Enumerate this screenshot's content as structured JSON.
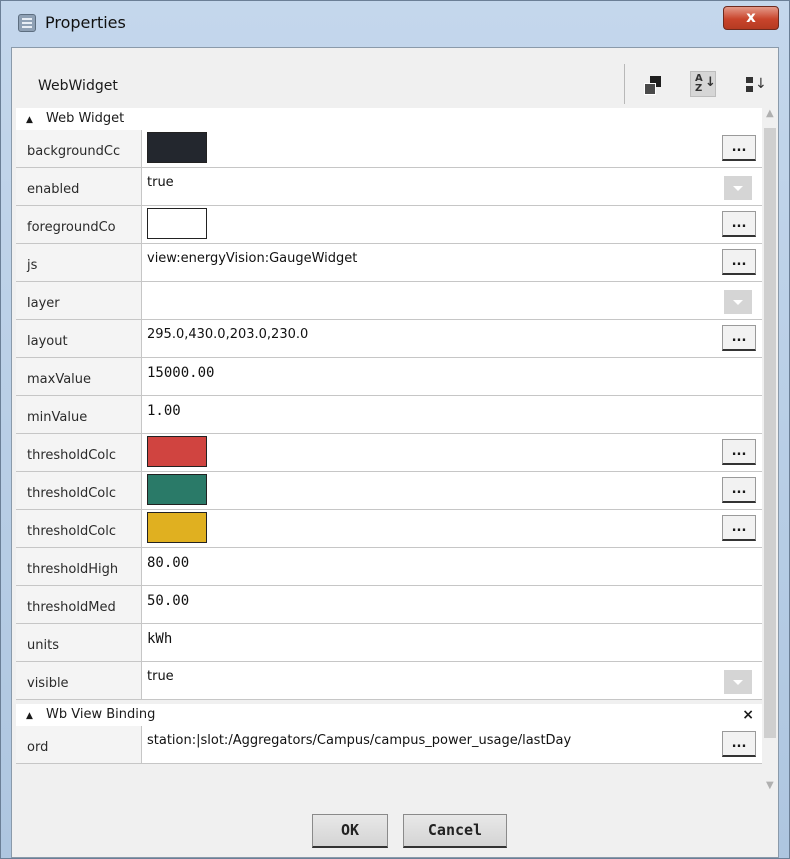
{
  "window": {
    "title": "Properties",
    "close_label": "x"
  },
  "header": {
    "title": "WebWidget"
  },
  "groups": {
    "web_widget": {
      "label": "Web Widget"
    },
    "wb_view_binding": {
      "label": "Wb View Binding",
      "close_glyph": "×"
    }
  },
  "properties": [
    {
      "name": "backgroundCc",
      "kind": "color",
      "color": "#23272e"
    },
    {
      "name": "enabled",
      "kind": "dropdown",
      "value": "true"
    },
    {
      "name": "foregroundCo",
      "kind": "color",
      "color": "#ffffff"
    },
    {
      "name": "js",
      "kind": "text-dots",
      "value": "view:energyVision:GaugeWidget"
    },
    {
      "name": "layer",
      "kind": "dropdown",
      "value": ""
    },
    {
      "name": "layout",
      "kind": "text-dots",
      "value": "295.0,430.0,203.0,230.0"
    },
    {
      "name": "maxValue",
      "kind": "number",
      "value": "15000.00"
    },
    {
      "name": "minValue",
      "kind": "number",
      "value": "1.00"
    },
    {
      "name": "thresholdColc",
      "kind": "color",
      "color": "#d04440"
    },
    {
      "name": "thresholdColc",
      "kind": "color",
      "color": "#2a7a68"
    },
    {
      "name": "thresholdColc",
      "kind": "color",
      "color": "#e0b020"
    },
    {
      "name": "thresholdHigh",
      "kind": "number",
      "value": "80.00"
    },
    {
      "name": "thresholdMed",
      "kind": "number",
      "value": "50.00"
    },
    {
      "name": "units",
      "kind": "number",
      "value": "kWh"
    },
    {
      "name": "visible",
      "kind": "dropdown",
      "value": "true"
    }
  ],
  "binding": [
    {
      "name": "ord",
      "kind": "text-dots",
      "value": "station:|slot:/Aggregators/Campus/campus_power_usage/lastDay"
    }
  ],
  "dots_label": "...",
  "buttons": {
    "ok": "OK",
    "cancel": "Cancel"
  }
}
